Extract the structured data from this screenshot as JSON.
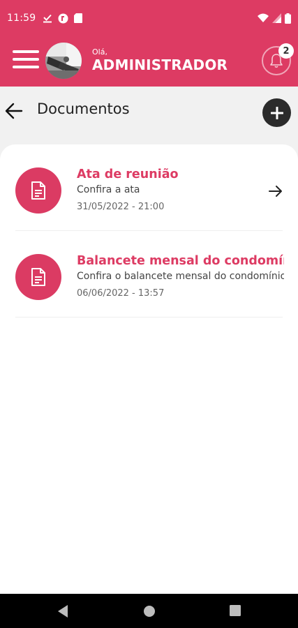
{
  "status_bar": {
    "time": "11:59",
    "left_icons": [
      "download-done-icon",
      "app-notification-icon",
      "sd-card-icon"
    ],
    "right_icons": [
      "wifi-icon",
      "signal-icon",
      "battery-icon"
    ]
  },
  "app_bar": {
    "greeting": "Olá,",
    "user_name": "ADMINISTRADOR",
    "notification_count": "2"
  },
  "page": {
    "title": "Documentos"
  },
  "documents": [
    {
      "title": "Ata de reunião",
      "subtitle": "Confira a ata",
      "date": "31/05/2022 - 21:00"
    },
    {
      "title": "Balancete mensal do condomínio",
      "subtitle": "Confira o balancete mensal do condomínio",
      "date": "06/06/2022 - 13:57"
    }
  ],
  "colors": {
    "brand": "#dd3b63",
    "fab": "#2b2b2b",
    "nav_bar": "#000000"
  }
}
